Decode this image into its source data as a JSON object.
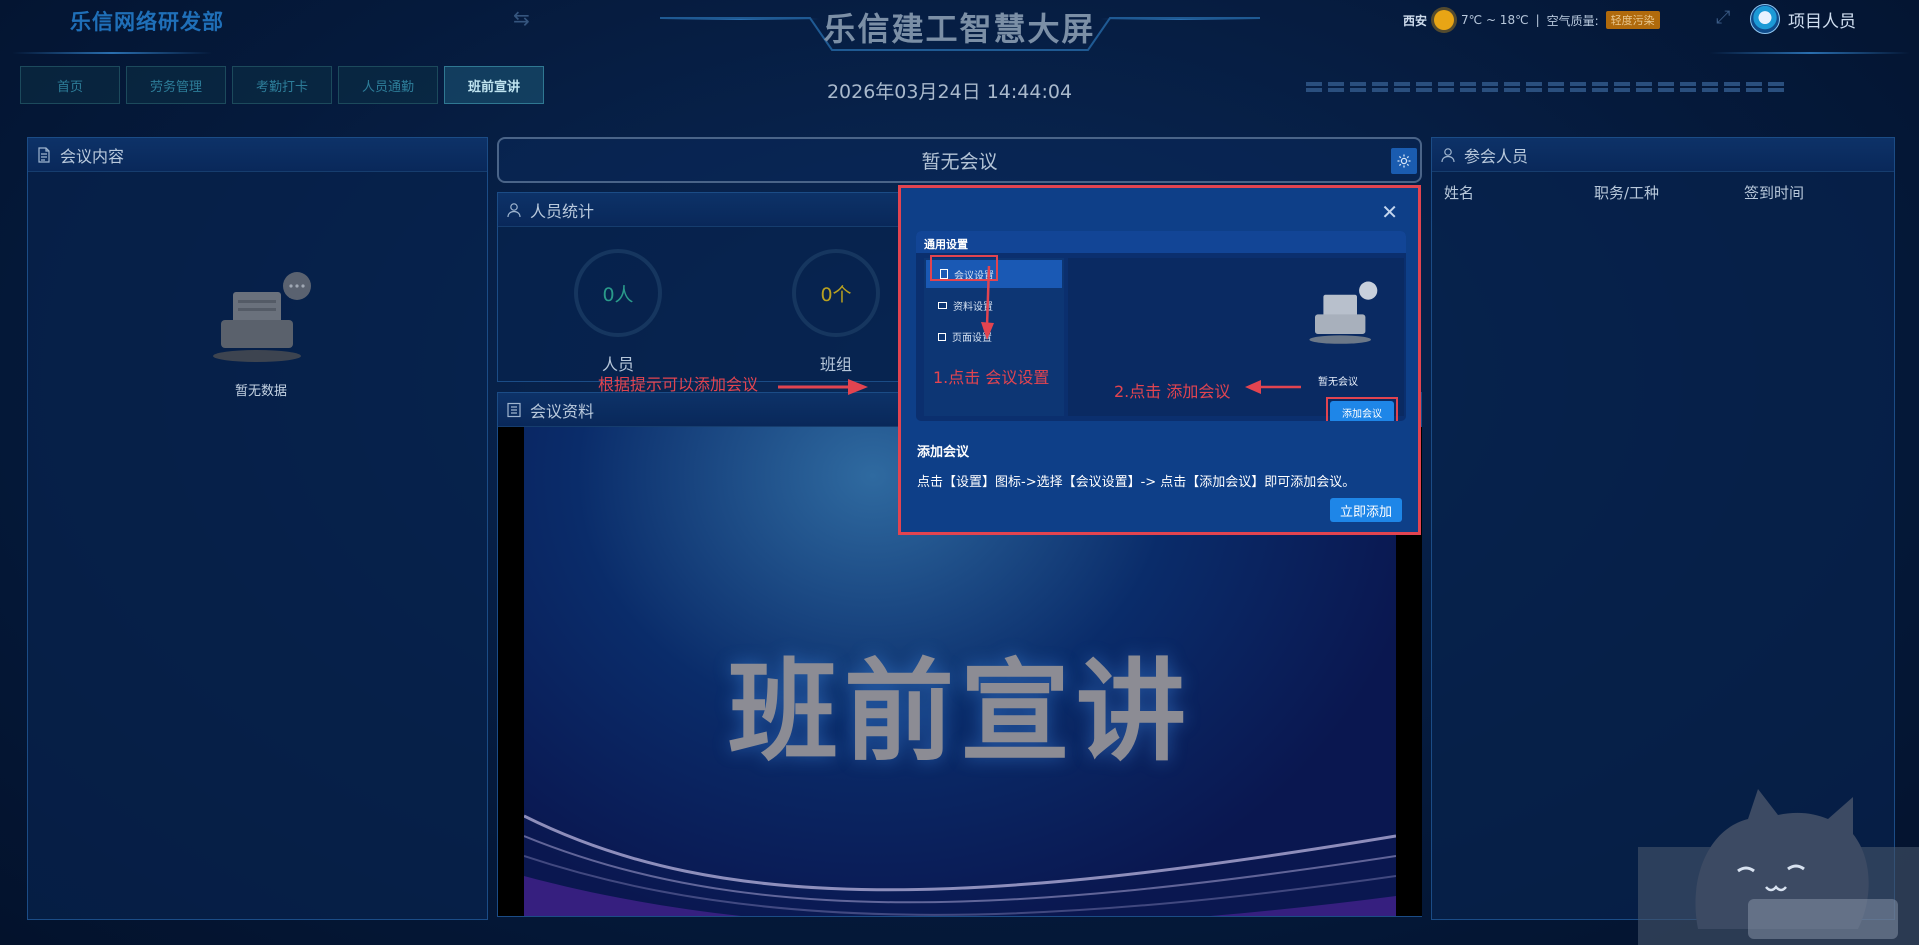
{
  "header": {
    "brand": "乐信网络研发部",
    "swap_glyph": "⇆",
    "title": "乐信建工智慧大屏",
    "datetime": "2026年03月24日 14:44:04",
    "weather": {
      "city": "西安",
      "temp": "7℃ ~ 18℃",
      "separator": "|",
      "aq_label": "空气质量:",
      "aq_value": "轻度污染"
    },
    "fullscreen_glyph": "⤢",
    "user": "项目人员"
  },
  "nav": [
    {
      "label": "首页"
    },
    {
      "label": "劳务管理"
    },
    {
      "label": "考勤打卡"
    },
    {
      "label": "人员通勤"
    },
    {
      "label": "班前宣讲"
    }
  ],
  "left_panel": {
    "title": "会议内容",
    "empty": "暂无数据"
  },
  "notice": {
    "text": "暂无会议"
  },
  "stats": {
    "title": "人员统计",
    "items": [
      {
        "value": "0人",
        "label": "人员",
        "color": "#2a9a8a"
      },
      {
        "value": "0个",
        "label": "班组",
        "color": "#b8a020"
      }
    ]
  },
  "materials": {
    "title": "会议资料",
    "video_title": "班前宣讲"
  },
  "right_panel": {
    "title": "参会人员",
    "columns": [
      "姓名",
      "职务/工种",
      "签到时间"
    ]
  },
  "hint": "根据提示可以添加会议",
  "modal": {
    "close_glyph": "✕",
    "inner_title": "通用设置",
    "menu": [
      {
        "label": "会议设置"
      },
      {
        "label": "资料设置"
      },
      {
        "label": "页面设置"
      }
    ],
    "empty_label": "暂无会议",
    "add_button": "添加会议",
    "step1": "1.点击 会议设置",
    "step2": "2.点击 添加会议",
    "section_title": "添加会议",
    "description": "点击【设置】图标->选择【会议设置】-> 点击【添加会议】即可添加会议。",
    "cta": "立即添加"
  },
  "colors": {
    "accent": "#1e86e8",
    "annotation_red": "#e24450",
    "background": "#04183a"
  }
}
